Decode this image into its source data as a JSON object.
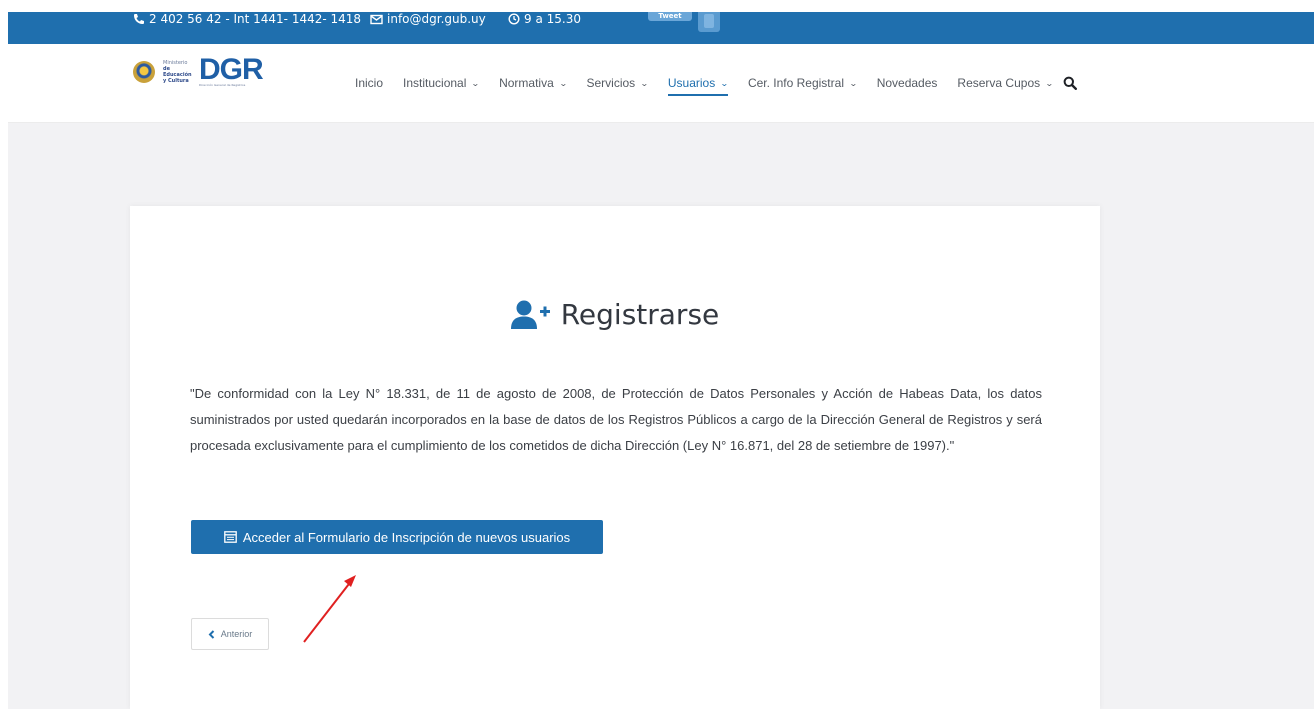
{
  "topbar": {
    "phone": "2 402 56 42 - Int 1441- 1442- 1418",
    "email": "info@dgr.gub.uy",
    "hours": "9 a 15.30",
    "tweet_label": "Tweet"
  },
  "logo": {
    "ministry_line1": "Ministerio",
    "ministry_line2": "de Educación",
    "ministry_line3": "y Cultura",
    "acronym": "DGR",
    "subtitle": "Dirección General de Registros"
  },
  "nav": {
    "items": [
      {
        "label": "Inicio",
        "has_dropdown": false
      },
      {
        "label": "Institucional",
        "has_dropdown": true
      },
      {
        "label": "Normativa",
        "has_dropdown": true
      },
      {
        "label": "Servicios",
        "has_dropdown": true
      },
      {
        "label": "Usuarios",
        "has_dropdown": true,
        "active": true
      },
      {
        "label": "Cer. Info Registral",
        "has_dropdown": true
      },
      {
        "label": "Novedades",
        "has_dropdown": false
      },
      {
        "label": "Reserva Cupos",
        "has_dropdown": true
      }
    ],
    "chevron": "❯"
  },
  "main": {
    "title": "Registrarse",
    "title_icon": "user-plus-icon",
    "legal_text": "\"De conformidad con la Ley N° 18.331, de 11 de agosto de 2008, de Protección de Datos Personales y Acción de Habeas Data, los datos suministrados por usted quedarán incorporados en la base de datos de los Registros Públicos a cargo de la Dirección General de Registros y será procesada exclusivamente para el cumplimiento de los cometidos de dicha Dirección (Ley N° 16.871, del 28 de setiembre de 1997).\"",
    "cta_label": "Acceder al Formulario de Inscripción de nuevos usuarios",
    "back_label": "Anterior"
  },
  "colors": {
    "brand_blue": "#1f6fae",
    "arrow_red": "#e02020",
    "page_bg": "#f2f2f4"
  }
}
